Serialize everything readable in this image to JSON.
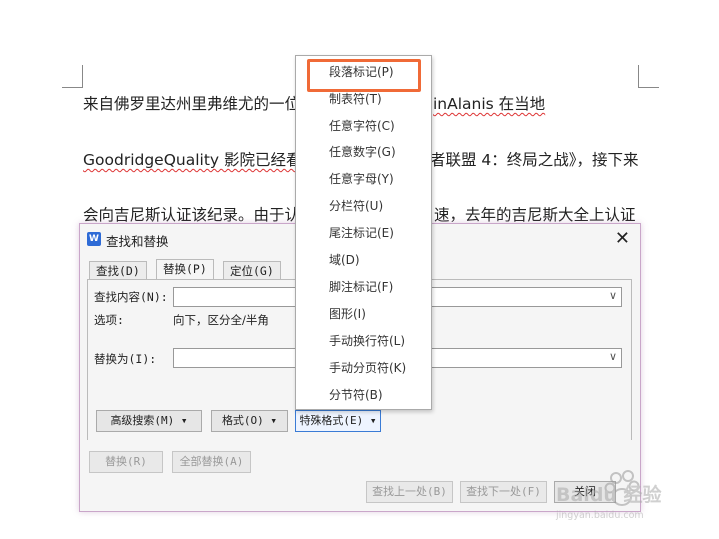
{
  "document": {
    "line1_a": "来自佛罗里达州里弗维尤的一位",
    "line1_b": "inAlanis 在当地",
    "line2_a": "GoodridgeQuality 影院已经看",
    "line2_b": "者联盟 4：终局之战》，接下来",
    "line3_a": "会向吉尼斯认证该纪录。由于认",
    "line3_b": "速，去年的吉尼斯大全上认证"
  },
  "dialog": {
    "app_icon_letter": "W",
    "title": "查找和替换",
    "close_label": "✕",
    "tabs": [
      {
        "label": "查找(D)"
      },
      {
        "label": "替换(P)"
      },
      {
        "label": "定位(G)"
      }
    ],
    "find_label": "查找内容(N):",
    "find_value": "",
    "options_label": "选项:",
    "options_value": "向下，区分全/半角",
    "replace_label": "替换为(I):",
    "replace_value": "",
    "combo_arrow": "∨",
    "advanced_search": "高级搜索(M) ▾",
    "format": "格式(O) ▾",
    "special_format": "特殊格式(E) ▾",
    "replace_btn": "替换(R)",
    "replace_all_btn": "全部替换(A)",
    "find_prev_btn": "查找上一处(B)",
    "find_next_btn": "查找下一处(F)",
    "close_btn": "关闭"
  },
  "menu": {
    "items": [
      "段落标记(P)",
      "制表符(T)",
      "任意字符(C)",
      "任意数字(G)",
      "任意字母(Y)",
      "分栏符(U)",
      "尾注标记(E)",
      "域(D)",
      "脚注标记(F)",
      "图形(I)",
      "手动换行符(L)",
      "手动分页符(K)",
      "分节符(B)"
    ],
    "highlight_color": "#f06a37"
  },
  "watermark": {
    "text": "Baidu 经验",
    "url": "jingyan.baidu.com"
  }
}
